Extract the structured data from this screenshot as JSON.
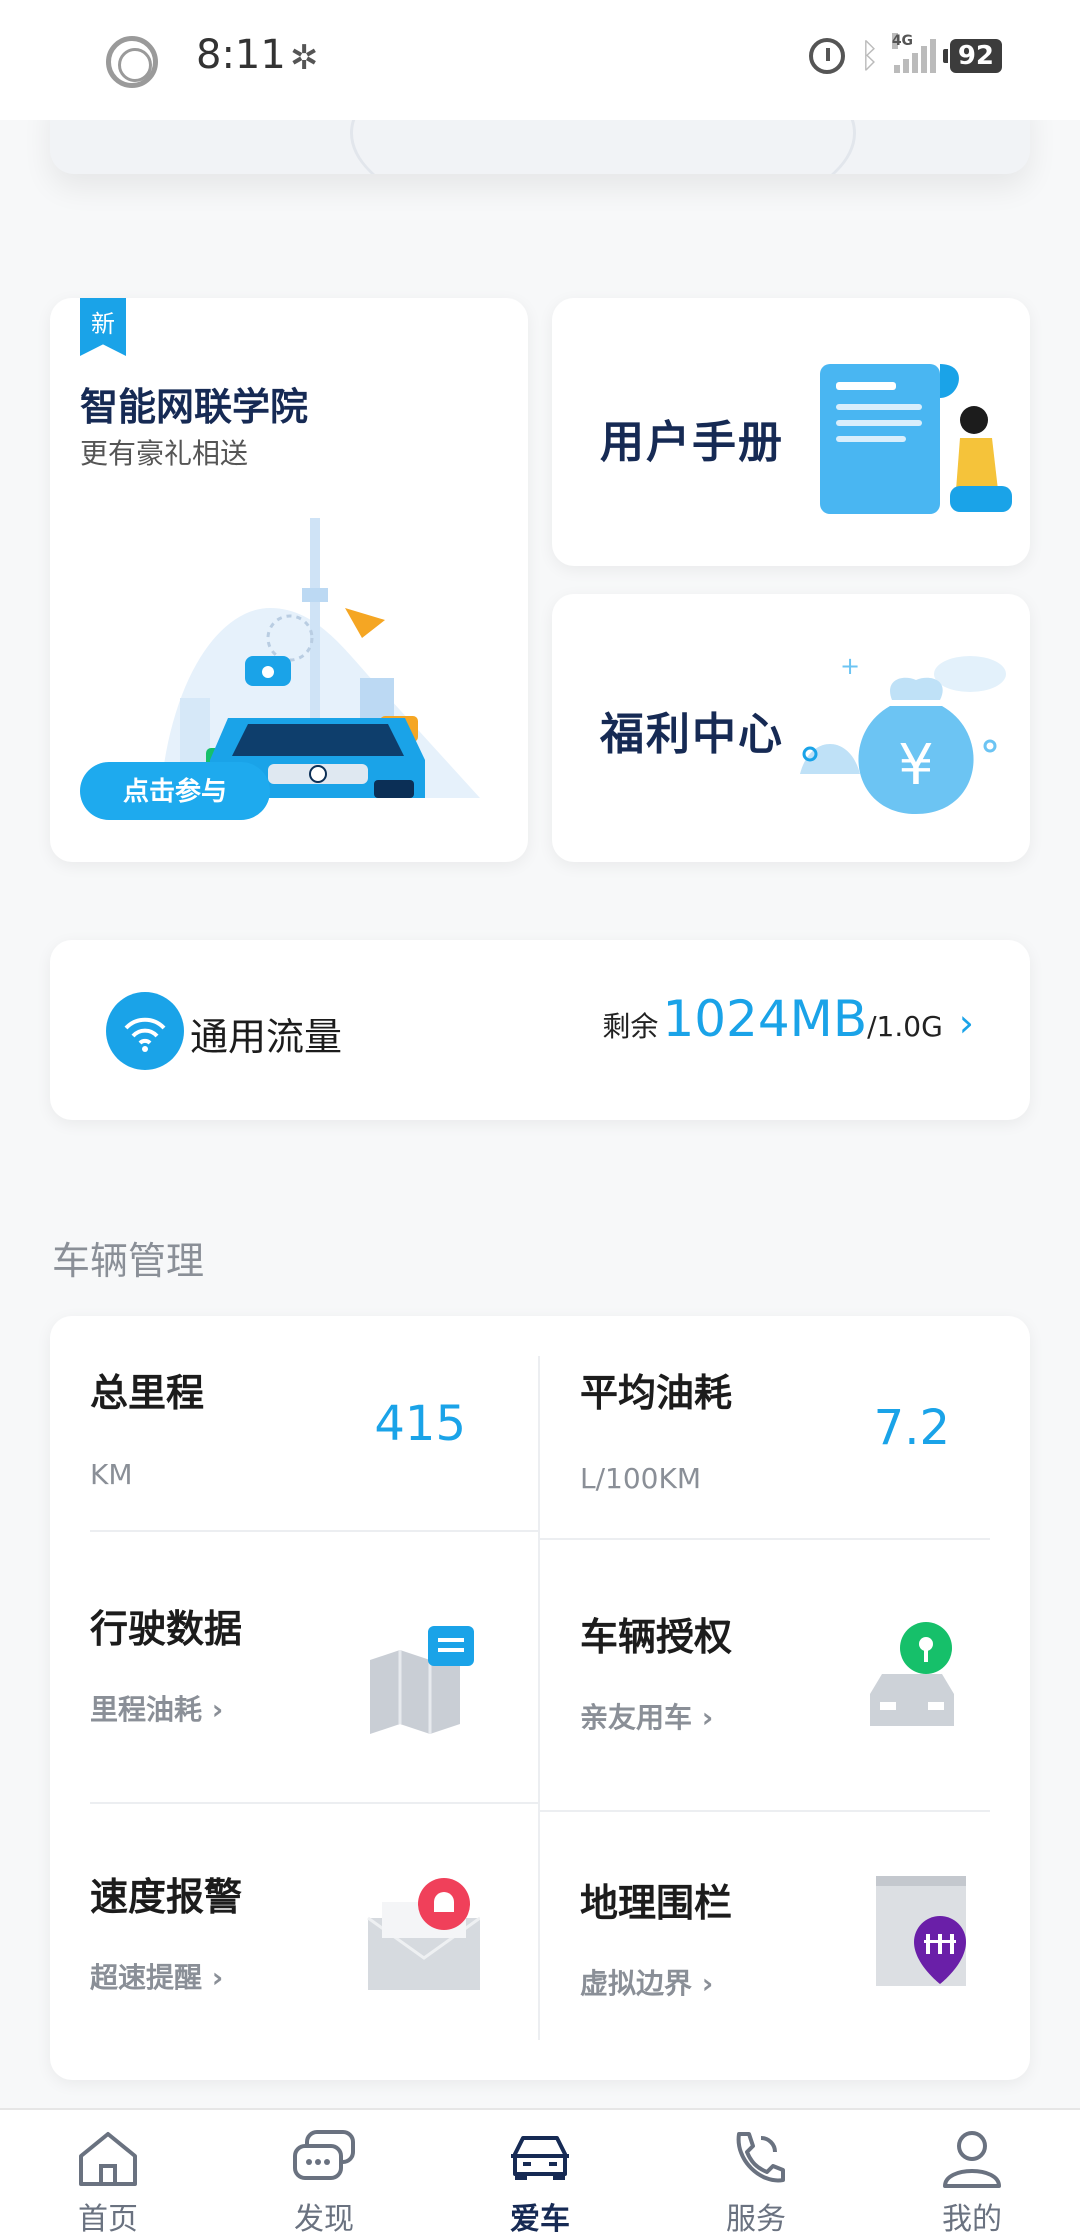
{
  "status_bar": {
    "time": "8:11",
    "signal_type": "4G",
    "battery": "92"
  },
  "promo": {
    "academy": {
      "badge": "新",
      "title": "智能网联学院",
      "subtitle": "更有豪礼相送",
      "button": "点击参与"
    },
    "manual": {
      "title": "用户手册"
    },
    "welfare": {
      "title": "福利中心"
    }
  },
  "data_plan": {
    "label": "通用流量",
    "remain_prefix": "剩余",
    "remain_amount": "1024MB",
    "total": "/1.0G"
  },
  "vehicle_mgmt": {
    "section_title": "车辆管理",
    "mileage": {
      "title": "总里程",
      "value": "415",
      "unit": "KM"
    },
    "fuel": {
      "title": "平均油耗",
      "value": "7.2",
      "unit": "L/100KM"
    },
    "driving": {
      "title": "行驶数据",
      "link": "里程油耗"
    },
    "authorization": {
      "title": "车辆授权",
      "link": "亲友用车"
    },
    "speed_alert": {
      "title": "速度报警",
      "link": "超速提醒"
    },
    "geofence": {
      "title": "地理围栏",
      "link": "虚拟边界"
    }
  },
  "bottom_nav": [
    {
      "label": "首页",
      "icon": "home-icon"
    },
    {
      "label": "发现",
      "icon": "chat-icon"
    },
    {
      "label": "爱车",
      "icon": "car-icon",
      "active": true
    },
    {
      "label": "服务",
      "icon": "phone-icon"
    },
    {
      "label": "我的",
      "icon": "profile-icon"
    }
  ],
  "colors": {
    "accent": "#1aa3e8",
    "title_navy": "#162a54",
    "muted": "#8a8f97",
    "alert_red": "#f0405a",
    "check_green": "#16c06a",
    "geofence_purple": "#6a1fa8"
  }
}
